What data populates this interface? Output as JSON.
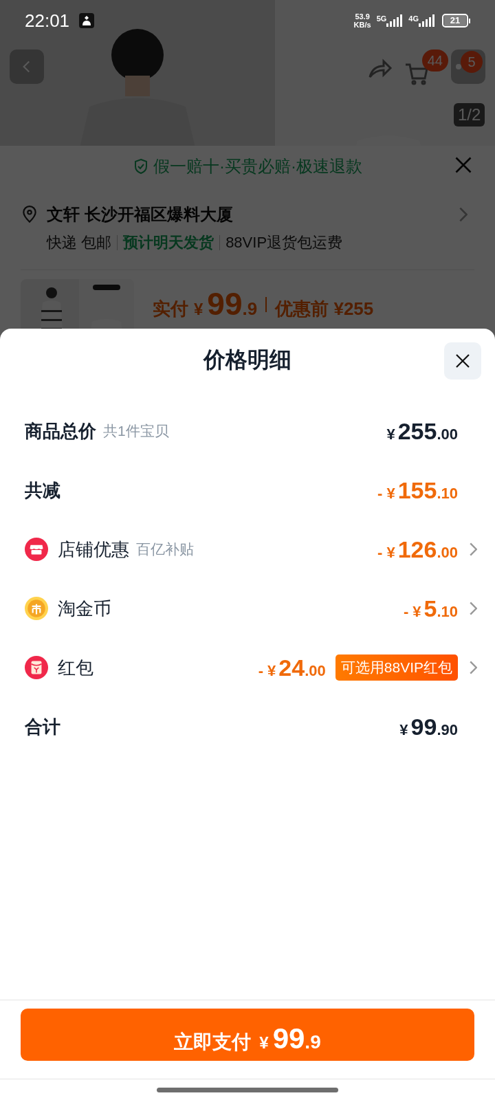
{
  "status_bar": {
    "time": "22:01",
    "net_speed": "53.9",
    "net_unit": "KB/s",
    "network_1": "5G",
    "network_2": "4G",
    "battery": "21"
  },
  "product_header": {
    "cart_badge": "44",
    "more_badge": "5",
    "image_counter": "1/2"
  },
  "checkout": {
    "guarantee": "假一赔十·买贵必赔·极速退款",
    "address": "文轩 长沙开福区爆料大厦",
    "shipping": [
      {
        "text": "快递 包邮",
        "highlight": false
      },
      {
        "text": "预计明天发货",
        "highlight": true
      },
      {
        "text": "88VIP退货包运费",
        "highlight": false
      }
    ],
    "price": {
      "label": "实付",
      "currency": "¥",
      "whole": "99",
      "fraction": ".9",
      "original": "优惠前 ¥255"
    }
  },
  "price_detail": {
    "title": "价格明细",
    "rows": [
      {
        "kind": "subtotal",
        "label": "商品总价",
        "note": "共1件宝贝",
        "amount": {
          "currency": "¥",
          "whole": "255",
          "fraction": ".00"
        },
        "negative": false
      },
      {
        "kind": "reduction",
        "label": "共减",
        "amount": {
          "sign": "-",
          "currency": "¥",
          "whole": "155",
          "fraction": ".10"
        },
        "negative": true
      },
      {
        "kind": "store",
        "label": "店铺优惠",
        "note": "百亿补贴",
        "amount": {
          "sign": "-",
          "currency": "¥",
          "whole": "126",
          "fraction": ".00"
        },
        "negative": true
      },
      {
        "kind": "coin",
        "label": "淘金币",
        "amount": {
          "sign": "-",
          "currency": "¥",
          "whole": "5",
          "fraction": ".10"
        },
        "negative": true
      },
      {
        "kind": "packet",
        "label": "红包",
        "amount": {
          "sign": "-",
          "currency": "¥",
          "whole": "24",
          "fraction": ".00"
        },
        "negative": true,
        "tag": "可选用88VIP红包"
      },
      {
        "kind": "total",
        "label": "合计",
        "amount": {
          "currency": "¥",
          "whole": "99",
          "fraction": ".90"
        },
        "negative": false
      }
    ],
    "pay_button": {
      "label": "立即支付",
      "currency": "¥",
      "whole": "99",
      "fraction": ".9"
    }
  }
}
